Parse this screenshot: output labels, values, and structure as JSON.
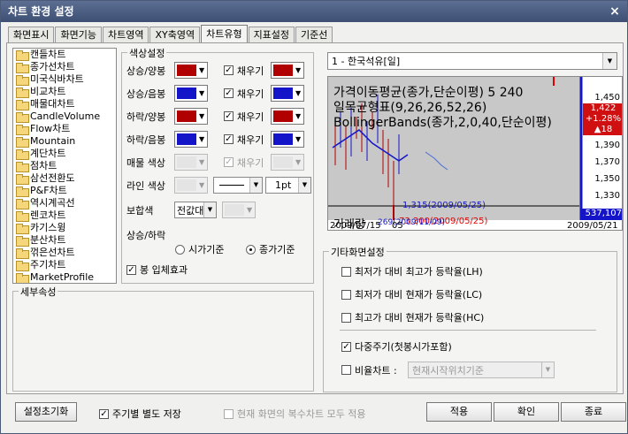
{
  "window": {
    "title": "차트 환경 설정",
    "close": "×"
  },
  "tabs": [
    "화면표시",
    "화면기능",
    "차트영역",
    "XY축영역",
    "차트유형",
    "지표설정",
    "기준선"
  ],
  "chart_types": [
    "캔들차트",
    "종가선차트",
    "미국식바차트",
    "비교차트",
    "매물대차트",
    "CandleVolume",
    "Flow차트",
    "Mountain",
    "계단차트",
    "점차트",
    "삼선전환도",
    "P&F차트",
    "역시계곡선",
    "렌코차트",
    "카기스윙",
    "분산차트",
    "꺾은선차트",
    "주기차트",
    "MarketProfile"
  ],
  "color_group": {
    "label": "색상설정",
    "rows": [
      {
        "label": "상승/양봉",
        "color": "#b00000",
        "fill_label": "채우기",
        "fill_checked": "✓",
        "fill_color": "#b00000"
      },
      {
        "label": "상승/음봉",
        "color": "#1414c8",
        "fill_label": "채우기",
        "fill_checked": "✓",
        "fill_color": "#1414c8"
      },
      {
        "label": "하락/양봉",
        "color": "#b00000",
        "fill_label": "채우기",
        "fill_checked": "✓",
        "fill_color": "#b00000"
      },
      {
        "label": "하락/음봉",
        "color": "#1414c8",
        "fill_label": "채우기",
        "fill_checked": "✓",
        "fill_color": "#1414c8"
      }
    ],
    "volume_label": "매물 색상",
    "volume_fill": "채우기",
    "line_label": "라인 색상",
    "line_width": "1pt",
    "mix_label": "보합색",
    "mix_value": "전값대비",
    "updown_label": "상승/하락",
    "radio_open": "시가기준",
    "radio_close": "종가기준",
    "candle3d": "봉 입체효과"
  },
  "detail_label": "세부속성",
  "preview": {
    "symbol": "1 - 한국석유[일]",
    "legend": [
      "가격이동평균(종가,단순이평)  5  240",
      "일목균형표(9,26,26,52,26)",
      "BollingerBands(종가,2,0,40,단순이평)"
    ],
    "volume": "거래량",
    "low_label": "1,315(2009/05/25)",
    "volume_annotation": "73,300(2009/05/25)",
    "volume_sub": "269(2009/11/09)",
    "price_box": "1,422",
    "change_pct": "+1.28%",
    "change_val": "▲18",
    "volume_box": "537,107",
    "xaxis": [
      "2009/07/15",
      "05",
      "2009/05/21"
    ],
    "yticks": [
      "1,450",
      "1,390",
      "1,370",
      "1,350",
      "1,330"
    ]
  },
  "chart_data": {
    "type": "line",
    "x": [],
    "values": []
  },
  "extra": {
    "label": "기타화면설정",
    "opt1": "최저가 대비 최고가 등락율(LH)",
    "opt2": "최저가 대비 현재가 등락율(LC)",
    "opt3": "최고가 대비 현재가 등락율(HC)",
    "opt4": "다중주기(첫봉시가포함)",
    "opt4_checked": "✓",
    "opt5": "비율차트 :",
    "opt5_value": "현재시작위치기준"
  },
  "footer": {
    "reset": "설정초기화",
    "cycle": "주기별 별도 저장",
    "cycle_checked": "✓",
    "apply_all": "현재 화면의 복수차트 모두 적용",
    "apply": "적용",
    "ok": "확인",
    "close": "종료"
  },
  "colors": {
    "title": "#4a5d82",
    "red": "#b00000",
    "blue": "#1414c8"
  }
}
